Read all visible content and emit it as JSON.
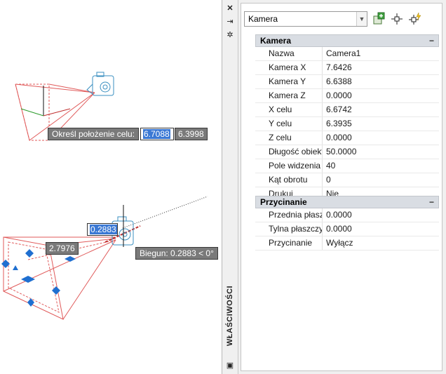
{
  "viewport": {
    "prompt_label": "Określ położenie celu:",
    "prompt_x": "6.7088",
    "prompt_y": "6.3998",
    "value_box_1": "0.2883",
    "value_box_2": "2.7976",
    "polar_tooltip": "Biegun: 0.2883 < 0°"
  },
  "palette": {
    "title": "WŁAŚCIWOŚCI",
    "icons": [
      "close-icon",
      "autohide-icon",
      "settings-icon",
      "properties-icon"
    ],
    "selector": "Kamera",
    "toolbar_icons": [
      "toggle-pickadd-icon",
      "select-objects-icon",
      "quick-select-icon"
    ],
    "sections": [
      {
        "title": "Kamera",
        "collapse": "−",
        "rows": [
          {
            "name": "Nazwa",
            "value": "Camera1"
          },
          {
            "name": "Kamera X",
            "value": "7.6426"
          },
          {
            "name": "Kamera Y",
            "value": "6.6388"
          },
          {
            "name": "Kamera Z",
            "value": "0.0000"
          },
          {
            "name": "X celu",
            "value": "6.6742"
          },
          {
            "name": "Y celu",
            "value": "6.3935"
          },
          {
            "name": "Z celu",
            "value": "0.0000"
          },
          {
            "name": "Długość obiekt...",
            "value": "50.0000"
          },
          {
            "name": "Pole widzenia",
            "value": "40"
          },
          {
            "name": "Kąt obrotu",
            "value": "0"
          },
          {
            "name": "Drukuj",
            "value": "Nie"
          }
        ]
      },
      {
        "title": "Przycinanie",
        "collapse": "−",
        "rows": [
          {
            "name": "Przednia płaszc...",
            "value": "0.0000"
          },
          {
            "name": "Tylna płaszczyz...",
            "value": "0.0000"
          },
          {
            "name": "Przycinanie",
            "value": "Wyłącz"
          }
        ]
      }
    ]
  },
  "colors": {
    "frustum": "#e05a5a",
    "camera": "#3a8fc0",
    "grip": "#1f6fd0",
    "tooltip_bg": "#7a7a7a",
    "section_header_bg": "#d9dde3"
  }
}
